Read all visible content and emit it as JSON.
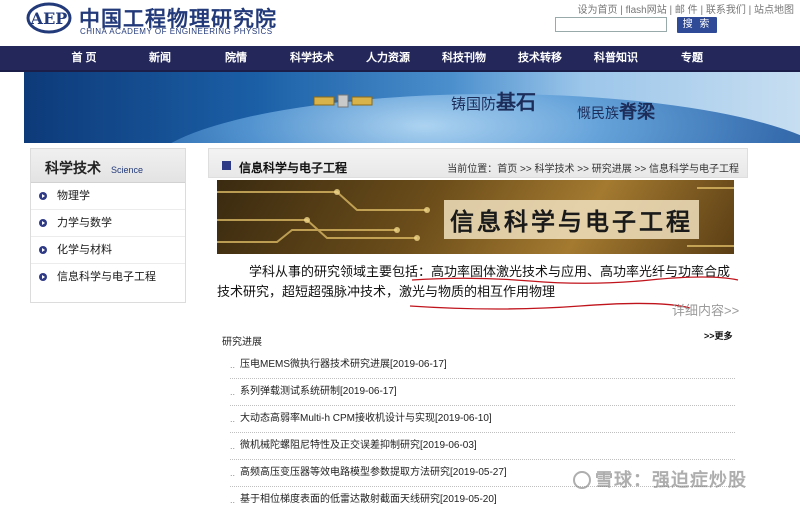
{
  "header": {
    "logo_cn": "中国工程物理研究院",
    "logo_en": "CHINA ACADEMY OF ENGINEERING PHYSICS",
    "toplinks": [
      "设为首页",
      "flash网站",
      "邮 件",
      "联系我们",
      "站点地图"
    ],
    "search_button": "搜 索",
    "search_value": ""
  },
  "nav": [
    "首 页",
    "新闻",
    "院情",
    "科学技术",
    "人力资源",
    "科技刊物",
    "技术转移",
    "科普知识",
    "专题"
  ],
  "banner": {
    "slogan1_a": "铸国防",
    "slogan1_b": "基石",
    "slogan2_a": "慨民族",
    "slogan2_b": "脊梁"
  },
  "sidebar": {
    "title_cn": "科学技术",
    "title_en": "Science",
    "items": [
      "物理学",
      "力学与数学",
      "化学与材料",
      "信息科学与电子工程"
    ]
  },
  "main": {
    "title": "信息科学与电子工程",
    "breadcrumb": "当前位置：首页 >> 科学技术 >> 研究进展 >> 信息科学与电子工程",
    "topic_banner_text": "信息科学与电子工程",
    "intro": "学科从事的研究领域主要包括：高功率固体激光技术与应用、高功率光纤与功率合成技术研究，超短超强脉冲技术，激光与物质的相互作用物理",
    "more_link": "详细内容>>",
    "section_title": "研究进展",
    "section_more": ">>更多",
    "news": [
      "压电MEMS微执行器技术研究进展[2019-06-17]",
      "系列弹载测试系统研制[2019-06-17]",
      "大动态高弱率Multi-h CPM接收机设计与实现[2019-06-10]",
      "微机械陀螺阻尼特性及正交误差抑制研究[2019-06-03]",
      "高频高压变压器等效电路模型参数提取方法研究[2019-05-27]",
      "基于相位梯度表面的低雷达散射截面天线研究[2019-05-20]"
    ]
  },
  "watermark": "雪球：强迫症炒股",
  "colors": {
    "nav_bg": "#23275a",
    "brand_blue": "#233a7a",
    "bullet": "#2f3a86"
  }
}
